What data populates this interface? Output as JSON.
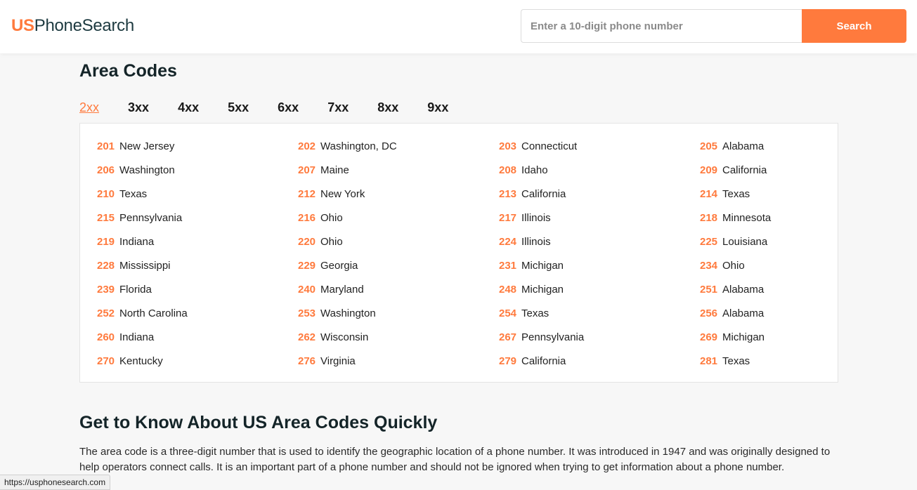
{
  "header": {
    "logo_us": "US",
    "logo_rest": "PhoneSearch",
    "search_placeholder": "Enter a 10-digit phone number",
    "search_value": "",
    "search_button": "Search"
  },
  "page_title": "Area Codes",
  "tabs": [
    {
      "label": "2xx",
      "active": true
    },
    {
      "label": "3xx",
      "active": false
    },
    {
      "label": "4xx",
      "active": false
    },
    {
      "label": "5xx",
      "active": false
    },
    {
      "label": "6xx",
      "active": false
    },
    {
      "label": "7xx",
      "active": false
    },
    {
      "label": "8xx",
      "active": false
    },
    {
      "label": "9xx",
      "active": false
    }
  ],
  "area_codes": [
    {
      "code": "201",
      "state": "New Jersey"
    },
    {
      "code": "202",
      "state": "Washington, DC"
    },
    {
      "code": "203",
      "state": "Connecticut"
    },
    {
      "code": "205",
      "state": "Alabama"
    },
    {
      "code": "206",
      "state": "Washington"
    },
    {
      "code": "207",
      "state": "Maine"
    },
    {
      "code": "208",
      "state": "Idaho"
    },
    {
      "code": "209",
      "state": "California"
    },
    {
      "code": "210",
      "state": "Texas"
    },
    {
      "code": "212",
      "state": "New York"
    },
    {
      "code": "213",
      "state": "California"
    },
    {
      "code": "214",
      "state": "Texas"
    },
    {
      "code": "215",
      "state": "Pennsylvania"
    },
    {
      "code": "216",
      "state": "Ohio"
    },
    {
      "code": "217",
      "state": "Illinois"
    },
    {
      "code": "218",
      "state": "Minnesota"
    },
    {
      "code": "219",
      "state": "Indiana"
    },
    {
      "code": "220",
      "state": "Ohio"
    },
    {
      "code": "224",
      "state": "Illinois"
    },
    {
      "code": "225",
      "state": "Louisiana"
    },
    {
      "code": "228",
      "state": "Mississippi"
    },
    {
      "code": "229",
      "state": "Georgia"
    },
    {
      "code": "231",
      "state": "Michigan"
    },
    {
      "code": "234",
      "state": "Ohio"
    },
    {
      "code": "239",
      "state": "Florida"
    },
    {
      "code": "240",
      "state": "Maryland"
    },
    {
      "code": "248",
      "state": "Michigan"
    },
    {
      "code": "251",
      "state": "Alabama"
    },
    {
      "code": "252",
      "state": "North Carolina"
    },
    {
      "code": "253",
      "state": "Washington"
    },
    {
      "code": "254",
      "state": "Texas"
    },
    {
      "code": "256",
      "state": "Alabama"
    },
    {
      "code": "260",
      "state": "Indiana"
    },
    {
      "code": "262",
      "state": "Wisconsin"
    },
    {
      "code": "267",
      "state": "Pennsylvania"
    },
    {
      "code": "269",
      "state": "Michigan"
    },
    {
      "code": "270",
      "state": "Kentucky"
    },
    {
      "code": "276",
      "state": "Virginia"
    },
    {
      "code": "279",
      "state": "California"
    },
    {
      "code": "281",
      "state": "Texas"
    }
  ],
  "section_title": "Get to Know About US Area Codes Quickly",
  "section_text": "The area code is a three-digit number that is used to identify the geographic location of a phone number. It was introduced in 1947 and was originally designed to help operators connect calls. It is an important part of a phone number and should not be ignored when trying to get information about a phone number.",
  "status_bar_url": "https://usphonesearch.com",
  "colors": {
    "accent": "#ff7a3d",
    "heading": "#142428",
    "logo_dark": "#1d3a40"
  }
}
